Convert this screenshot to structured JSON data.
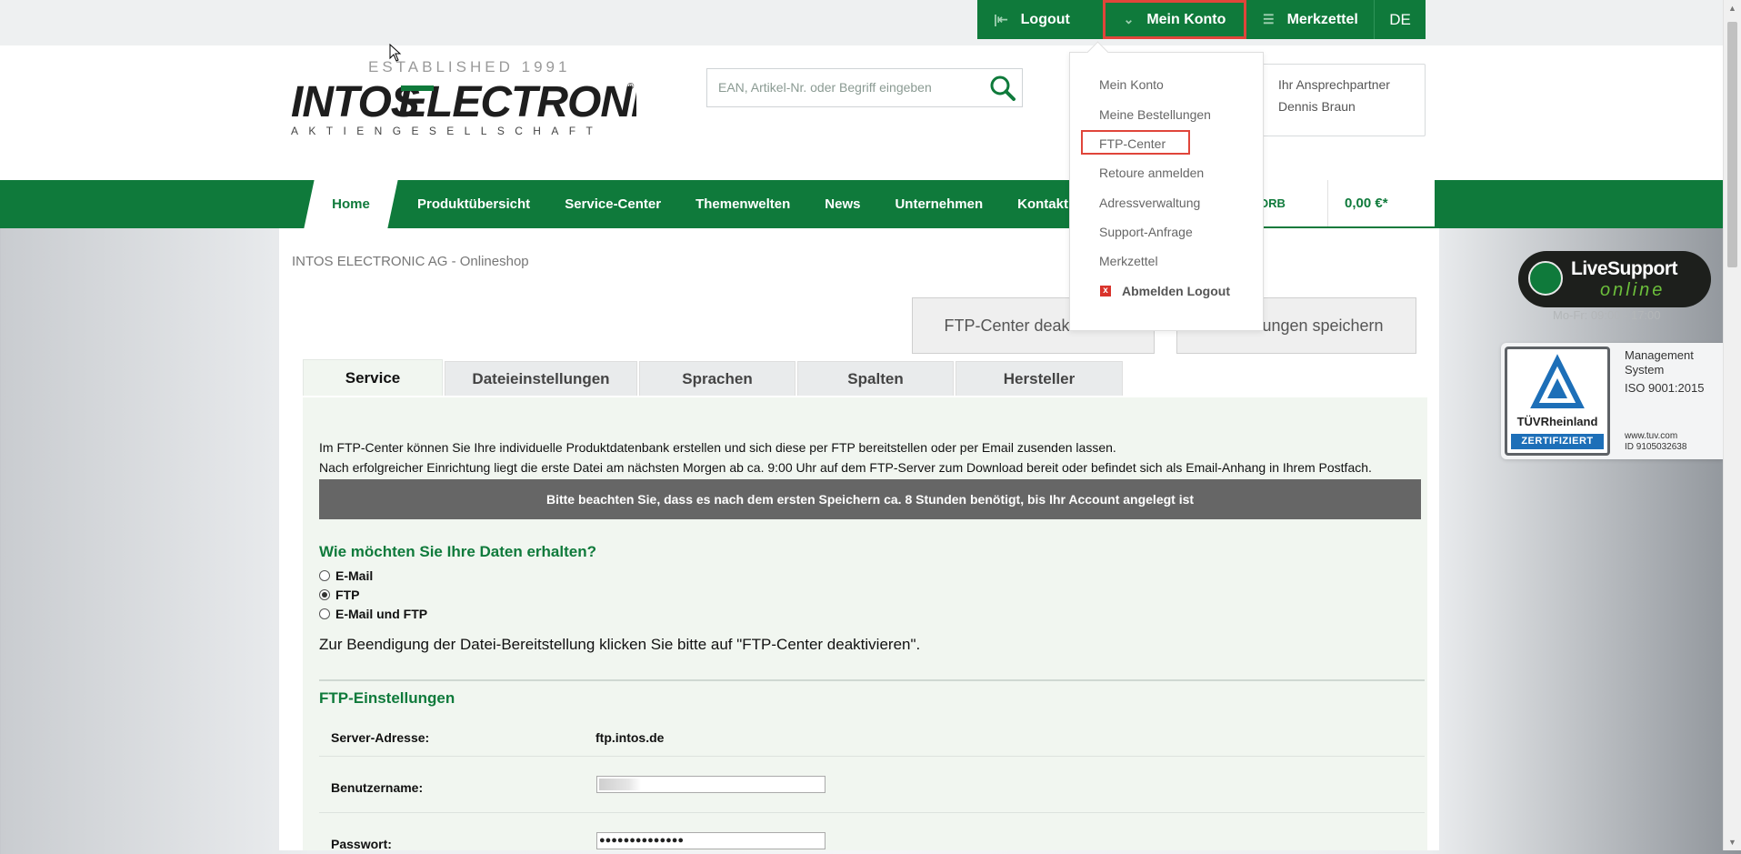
{
  "topbar": {
    "logout": "Logout",
    "mein_konto": "Mein Konto",
    "merkzettel": "Merkzettel",
    "lang": "DE"
  },
  "logo": {
    "established": "ESTABLISHED 1991",
    "brand_left": "INTOS",
    "brand_right": "ELECTRONIC",
    "subline": "AKTIENGESELLSCHAFT"
  },
  "search": {
    "placeholder": "EAN, Artikel-Nr. oder Begriff eingeben"
  },
  "contact": {
    "title": "Ihr Ansprechpartner",
    "name": "Dennis Braun"
  },
  "nav": {
    "items": [
      "Home",
      "Produktübersicht",
      "Service-Center",
      "Themenwelten",
      "News",
      "Unternehmen",
      "Kontakt"
    ]
  },
  "cart": {
    "korb": "ORB",
    "price": "0,00 €*"
  },
  "dropdown": {
    "items": [
      "Mein Konto",
      "Meine Bestellungen",
      "FTP-Center",
      "Retoure anmelden",
      "Adressverwaltung",
      "Support-Anfrage",
      "Merkzettel"
    ],
    "logout": "Abmelden Logout"
  },
  "breadcrumb": "INTOS ELECTRONIC AG - Onlineshop",
  "buttons": {
    "deactivate": "FTP-Center deaktivieren",
    "save": "Einstellungen speichern"
  },
  "tabs": [
    "Service",
    "Dateieinstellungen",
    "Sprachen",
    "Spalten",
    "Hersteller"
  ],
  "service": {
    "intro_1": "Im FTP-Center können Sie Ihre individuelle Produktdatenbank erstellen und sich diese per FTP bereitstellen oder per Email zusenden lassen.",
    "intro_2": "Nach erfolgreicher Einrichtung liegt die erste Datei am nächsten Morgen ab ca. 9:00 Uhr auf dem FTP-Server zum Download bereit oder befindet sich als Email-Anhang in Ihrem Postfach.",
    "notice": "Bitte beachten Sie, dass es nach dem ersten Speichern ca. 8 Stunden benötigt, bis Ihr Account angelegt ist",
    "question": "Wie möchten Sie Ihre Daten erhalten?",
    "options": [
      "E-Mail",
      "FTP",
      "E-Mail und FTP"
    ],
    "selected_option": "FTP",
    "end_text": "Zur Beendigung der Datei-Bereitstellung klicken Sie bitte auf \"FTP-Center deaktivieren\".",
    "ftp_heading": "FTP-Einstellungen",
    "server_label": "Server-Adresse:",
    "server_value": "ftp.intos.de",
    "user_label": "Benutzername:",
    "password_label": "Passwort:",
    "password_value": "●●●●●●●●●●●●●●"
  },
  "livesupport": {
    "title": "LiveSupport",
    "status": "online",
    "hours": "Mo-Fr: 09:00 - 17:00"
  },
  "tuv": {
    "name": "TÜVRheinland",
    "cert": "ZERTIFIZIERT",
    "line1": "Management",
    "line2": "System",
    "line3": "ISO 9001:2015",
    "web": "www.tuv.com",
    "id": "ID 9105032638"
  },
  "colors": {
    "brand_green": "#0f7a3b",
    "highlight_red": "#e0453a",
    "notice_gray": "#666666"
  }
}
